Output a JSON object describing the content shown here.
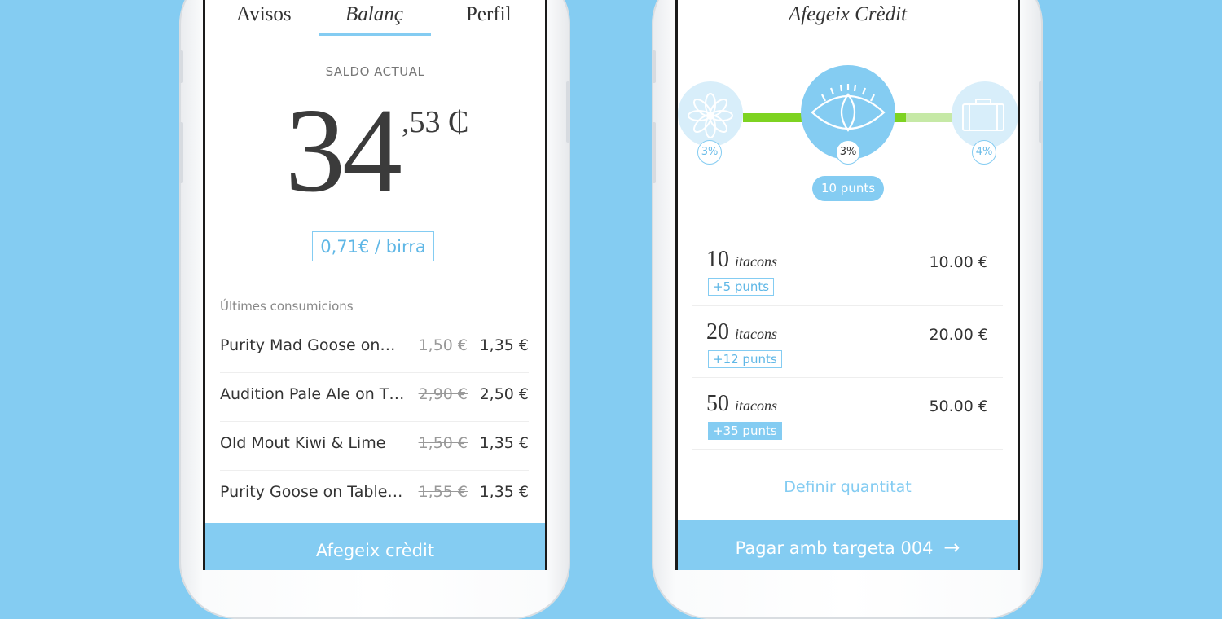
{
  "colors": {
    "accent": "#84ccf2",
    "progress_green": "#7ed321",
    "progress_green_light": "#c6e9a6"
  },
  "screen1": {
    "tabs": [
      {
        "label": "Avisos"
      },
      {
        "label": "Balanç"
      },
      {
        "label": "Perfil"
      }
    ],
    "active_tab": "Balanç",
    "saldo_label": "SALDO ACTUAL",
    "saldo_integer": "34",
    "saldo_decimal": ",53 ₵",
    "rate": "0,71€ / birra",
    "consumptions_title": "Últimes consumicions",
    "consumptions": [
      {
        "name": "Purity Mad Goose on…",
        "old_price": "1,50 €",
        "price": "1,35 €"
      },
      {
        "name": "Audition Pale Ale on T…",
        "old_price": "2,90 €",
        "price": "2,50 €"
      },
      {
        "name": "Old Mout Kiwi & Lime",
        "old_price": "1,50 €",
        "price": "1,35 €"
      },
      {
        "name": "Purity Goose on Table…",
        "old_price": "1,55 €",
        "price": "1,35 €"
      }
    ],
    "add_credit_button": "Afegeix crèdit"
  },
  "screen2": {
    "title": "Afegeix Crèdit",
    "levels": [
      {
        "icon": "flower-icon",
        "pct": "3%"
      },
      {
        "icon": "eye-icon",
        "pct": "3%"
      },
      {
        "icon": "suitcase-icon",
        "pct": "4%"
      }
    ],
    "points_pill": "10 punts",
    "options": [
      {
        "qty": "10",
        "unit": "itacons",
        "price": "10.00 €",
        "badge": "+5 punts",
        "highlighted": false
      },
      {
        "qty": "20",
        "unit": "itacons",
        "price": "20.00 €",
        "badge": "+12 punts",
        "highlighted": false
      },
      {
        "qty": "50",
        "unit": "itacons",
        "price": "50.00 €",
        "badge": "+35 punts",
        "highlighted": true
      }
    ],
    "custom_amount_link": "Definir quantitat",
    "pay_button": "Pagar amb targeta 004",
    "pay_arrow": "→"
  }
}
